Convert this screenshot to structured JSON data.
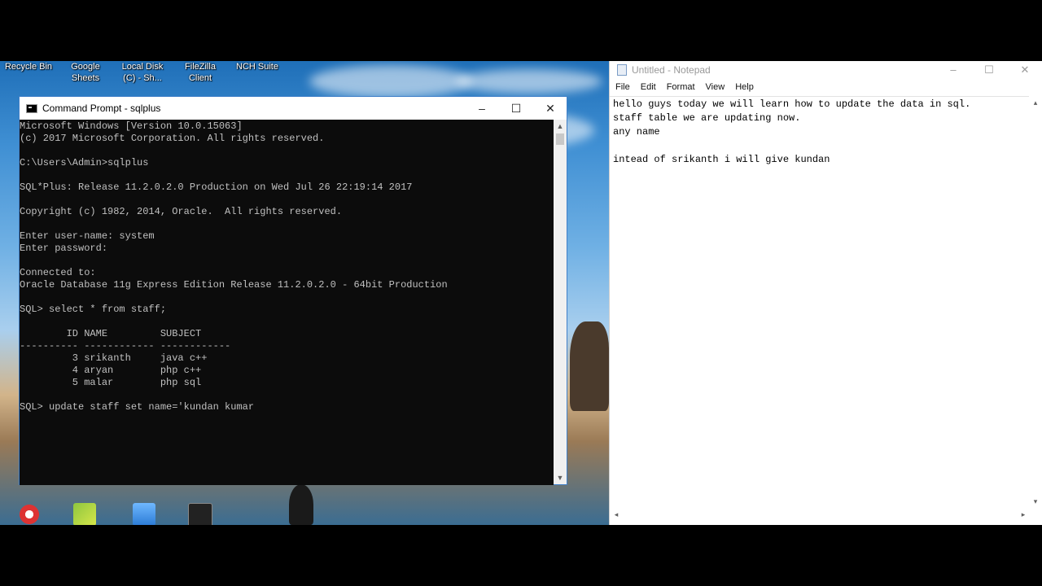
{
  "desktop": {
    "icons": [
      {
        "label": "Recycle Bin"
      },
      {
        "label": "Google Sheets"
      },
      {
        "label": "Local Disk (C) - Sh..."
      },
      {
        "label": "FileZilla Client"
      },
      {
        "label": "NCH Suite"
      }
    ]
  },
  "cmd": {
    "title": "Command Prompt - sqlplus",
    "lines": [
      "Microsoft Windows [Version 10.0.15063]",
      "(c) 2017 Microsoft Corporation. All rights reserved.",
      "",
      "C:\\Users\\Admin>sqlplus",
      "",
      "SQL*Plus: Release 11.2.0.2.0 Production on Wed Jul 26 22:19:14 2017",
      "",
      "Copyright (c) 1982, 2014, Oracle.  All rights reserved.",
      "",
      "Enter user-name: system",
      "Enter password:",
      "",
      "Connected to:",
      "Oracle Database 11g Express Edition Release 11.2.0.2.0 - 64bit Production",
      "",
      "SQL> select * from staff;",
      "",
      "        ID NAME         SUBJECT",
      "---------- ------------ ------------",
      "         3 srikanth     java c++",
      "         4 aryan        php c++",
      "         5 malar        php sql",
      "",
      "SQL> update staff set name='kundan kumar"
    ]
  },
  "notepad": {
    "title": "Untitled - Notepad",
    "menu": [
      "File",
      "Edit",
      "Format",
      "View",
      "Help"
    ],
    "lines": [
      "hello guys today we will learn how to update the data in sql.",
      "staff table we are updating now.",
      "any name",
      "",
      "intead of srikanth i will give kundan"
    ]
  }
}
